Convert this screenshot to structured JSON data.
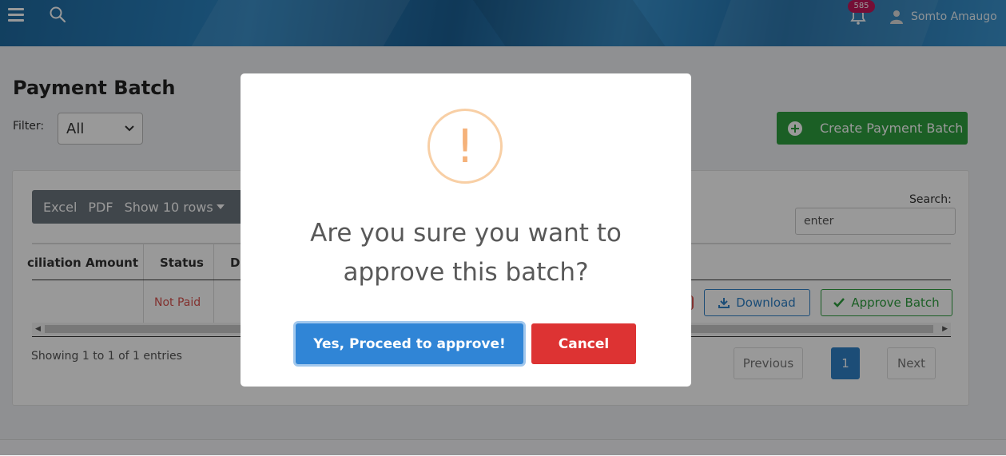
{
  "header": {
    "notification_count": "585",
    "user_name": "Somto Amaugo"
  },
  "page": {
    "title": "Payment Batch",
    "filter_label": "Filter:",
    "filter_value": "All",
    "create_button_label": "Create Payment Batch"
  },
  "table": {
    "toolbar": [
      "Excel",
      "PDF",
      "Show 10 rows"
    ],
    "search_label": "Search:",
    "search_value": "enter",
    "columns": [
      "ciliation Amount",
      "Status",
      "Da"
    ],
    "rows": [
      {
        "status": "Not Paid",
        "download_label": "Download",
        "approve_label": "Approve Batch"
      }
    ],
    "info": "Showing 1 to 1 of 1 entries",
    "pagination": {
      "previous": "Previous",
      "current": "1",
      "next": "Next"
    }
  },
  "modal": {
    "icon": "!",
    "title": "Are you sure you want to approve this batch?",
    "confirm_label": "Yes, Proceed to approve!",
    "cancel_label": "Cancel"
  },
  "colors": {
    "header": "#2c86c4",
    "create_button": "#2e9e3e",
    "confirm_button": "#3085d6",
    "cancel_button": "#dd3333",
    "warning_icon": "#f8bb86",
    "status_not_paid": "#d9534f"
  }
}
